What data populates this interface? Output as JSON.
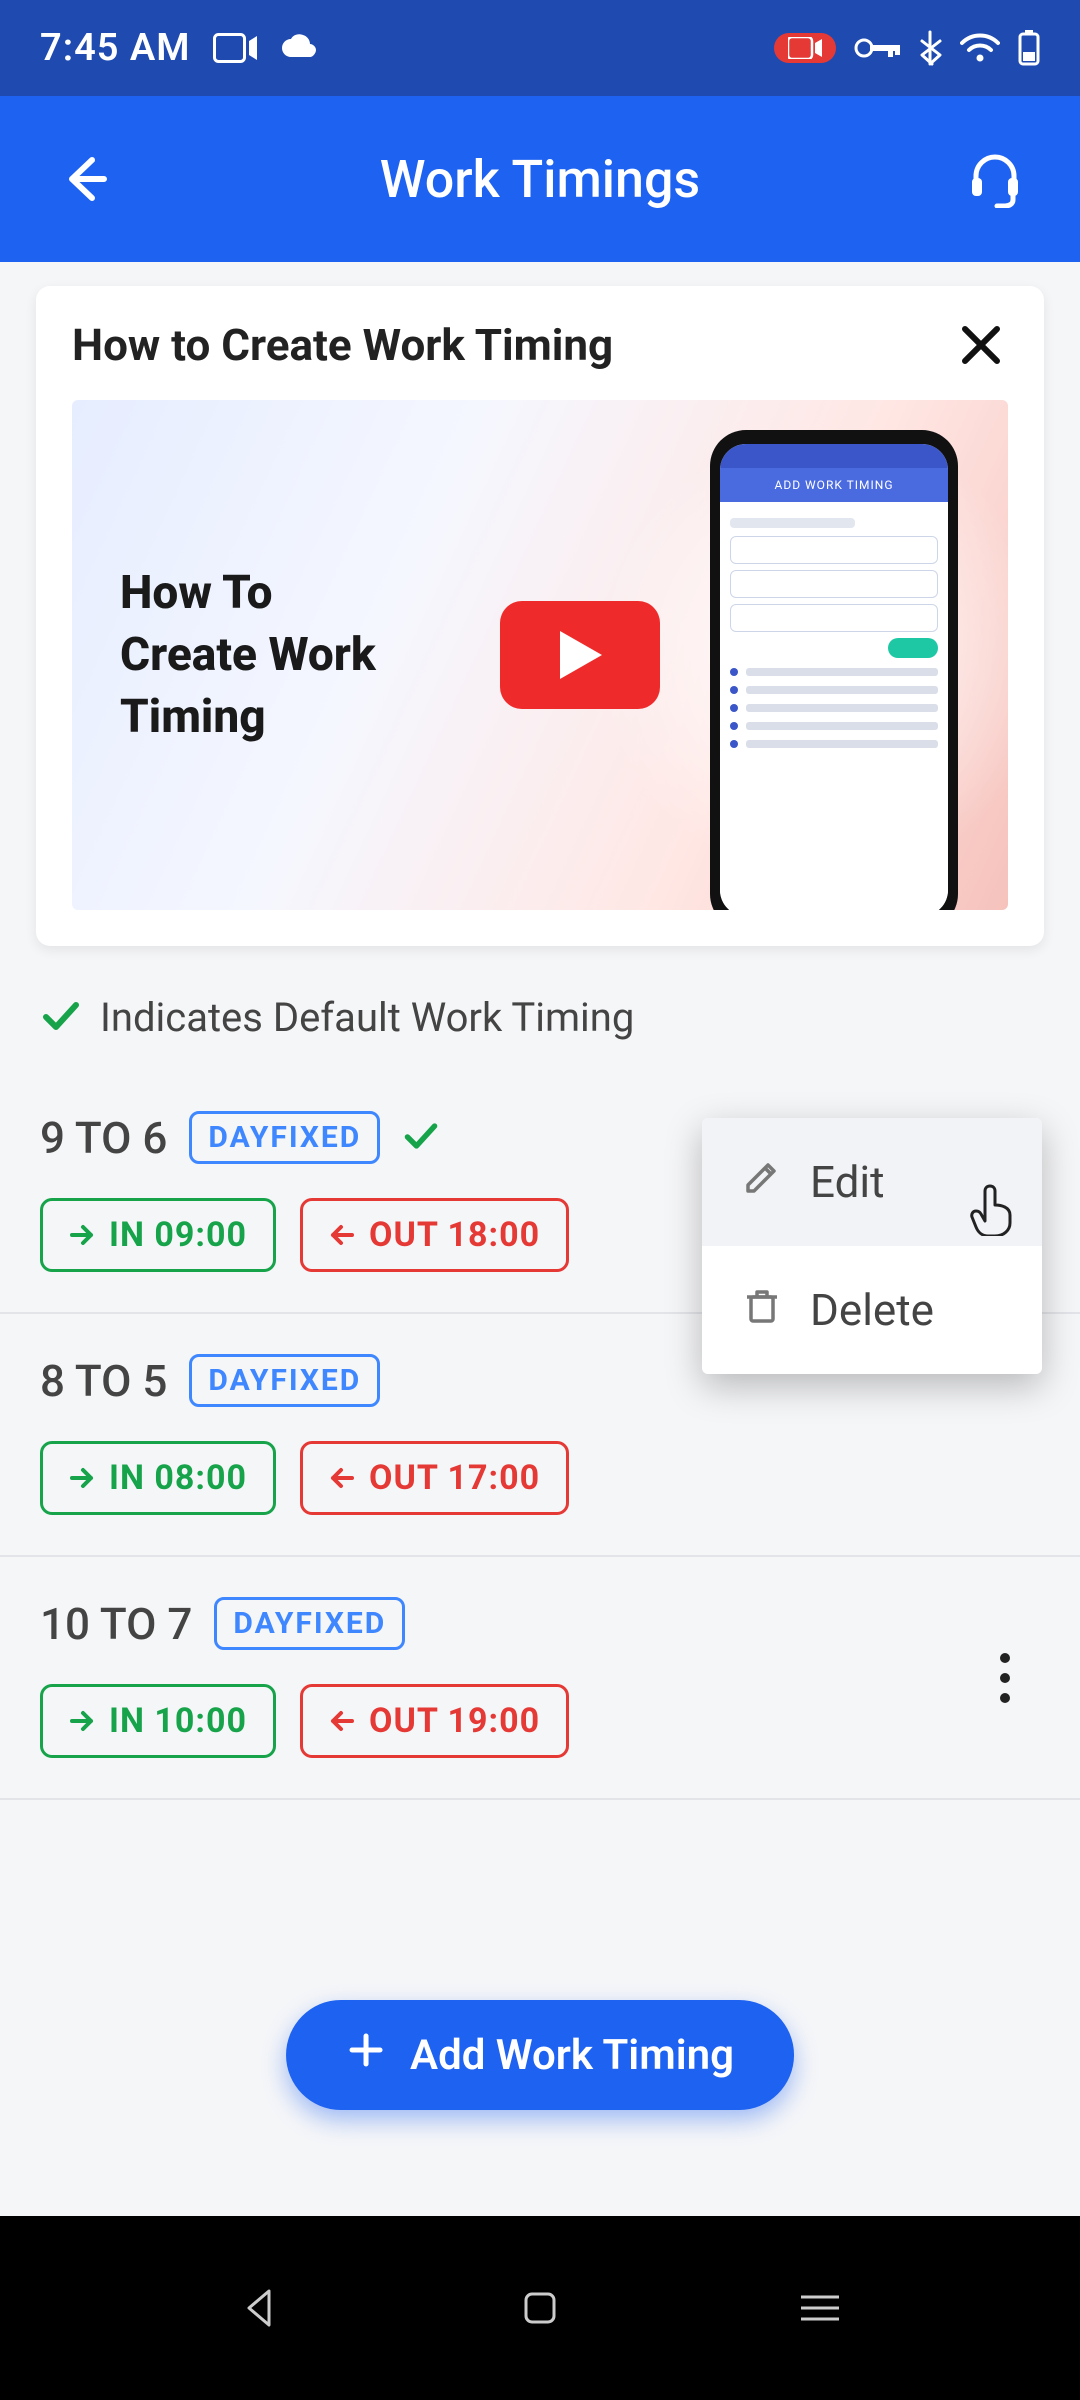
{
  "status": {
    "time": "7:45 AM"
  },
  "appbar": {
    "title": "Work Timings"
  },
  "howto": {
    "card_title": "How to Create Work Timing",
    "thumb_line1": "How To",
    "thumb_line2": "Create Work",
    "thumb_line3": "Timing"
  },
  "legend": {
    "text": "Indicates Default Work Timing"
  },
  "timings": [
    {
      "name": "9 TO 6",
      "badge": "DAYFIXED",
      "default": true,
      "in": "IN 09:00",
      "out": "OUT 18:00"
    },
    {
      "name": "8 TO 5",
      "badge": "DAYFIXED",
      "default": false,
      "in": "IN 08:00",
      "out": "OUT 17:00"
    },
    {
      "name": "10 TO 7",
      "badge": "DAYFIXED",
      "default": false,
      "in": "IN 10:00",
      "out": "OUT 19:00"
    }
  ],
  "popup": {
    "edit": "Edit",
    "delete": "Delete"
  },
  "fab": {
    "label": "Add Work Timing"
  }
}
